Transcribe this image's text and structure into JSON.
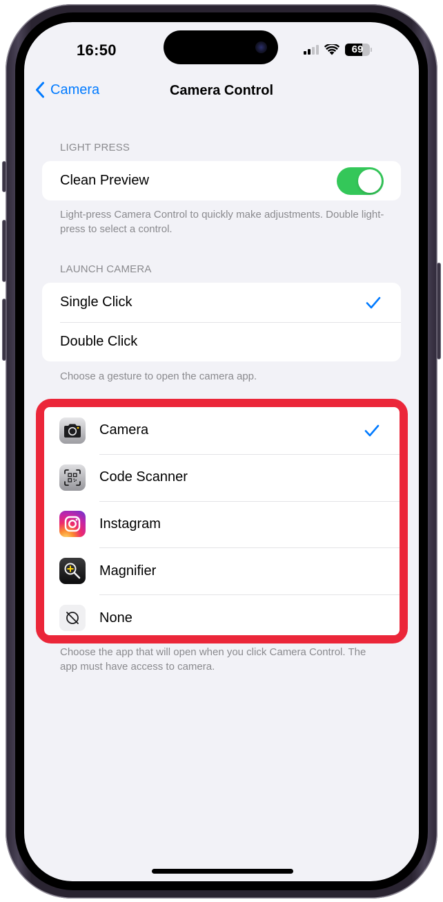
{
  "status_bar": {
    "time": "16:50",
    "battery_percent": "69",
    "battery_level": 0.69,
    "signal_bars_active": 2,
    "signal_bars_total": 4
  },
  "nav": {
    "back_label": "Camera",
    "title": "Camera Control"
  },
  "light_press": {
    "header": "LIGHT PRESS",
    "rows": [
      {
        "label": "Clean Preview",
        "toggle_on": true
      }
    ],
    "footer": "Light-press Camera Control to quickly make adjustments. Double light-press to select a control."
  },
  "launch_camera": {
    "header": "LAUNCH CAMERA",
    "rows": [
      {
        "label": "Single Click",
        "selected": true
      },
      {
        "label": "Double Click",
        "selected": false
      }
    ],
    "footer": "Choose a gesture to open the camera app."
  },
  "app_selection": {
    "rows": [
      {
        "label": "Camera",
        "icon": "camera-app-icon",
        "selected": true
      },
      {
        "label": "Code Scanner",
        "icon": "code-scanner-app-icon",
        "selected": false
      },
      {
        "label": "Instagram",
        "icon": "instagram-app-icon",
        "selected": false
      },
      {
        "label": "Magnifier",
        "icon": "magnifier-app-icon",
        "selected": false
      },
      {
        "label": "None",
        "icon": "none-slash-icon",
        "selected": false
      }
    ],
    "footer": "Choose the app that will open when you click Camera Control. The app must have access to camera.",
    "highlight_color": "#eb2639"
  },
  "colors": {
    "accent": "#007aff",
    "toggle_on": "#34c759",
    "background": "#f2f2f7",
    "secondary_text": "#8a8a8e"
  }
}
